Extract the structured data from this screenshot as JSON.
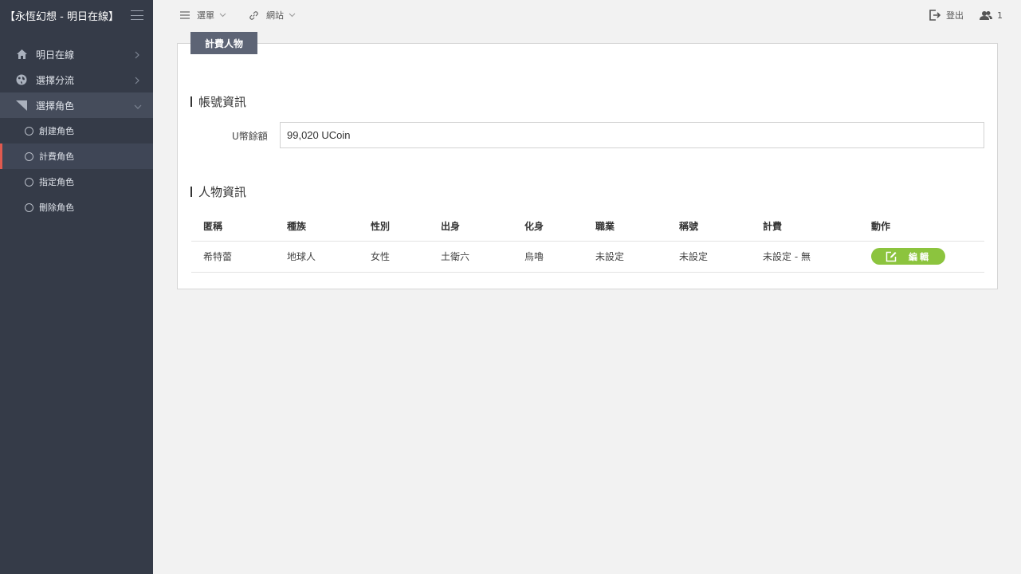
{
  "brand": {
    "title": "【永恆幻想 - 明日在線】"
  },
  "sidebar": {
    "items": [
      {
        "label": "明日在線",
        "icon": "home-icon"
      },
      {
        "label": "選擇分流",
        "icon": "globe-icon"
      },
      {
        "label": "選擇角色",
        "icon": "triangle-icon"
      }
    ],
    "sub_items": [
      {
        "label": "創建角色"
      },
      {
        "label": "計費角色"
      },
      {
        "label": "指定角色"
      },
      {
        "label": "刪除角色"
      }
    ]
  },
  "topbar": {
    "menu_label": "選單",
    "site_label": "網站",
    "logout_label": "登出",
    "users_count": "1"
  },
  "panel": {
    "tab_label": "計費人物",
    "account_section_title": "帳號資訊",
    "balance_label": "U幣餘額",
    "balance_value": "99,020 UCoin",
    "character_section_title": "人物資訊"
  },
  "table": {
    "headers": [
      "匿稱",
      "種族",
      "性別",
      "出身",
      "化身",
      "職業",
      "稱號",
      "計費",
      "動作"
    ],
    "rows": [
      {
        "cells": [
          "希特蕾",
          "地球人",
          "女性",
          "土衛六",
          "烏嚕",
          "未設定",
          "未設定",
          "未設定 - 無"
        ],
        "action_label": "編輯"
      }
    ]
  },
  "colors": {
    "sidebar_bg": "#353b48",
    "active_accent": "#e05a4f",
    "edit_button": "#8cc43e",
    "tab_bg": "#5d6475"
  }
}
